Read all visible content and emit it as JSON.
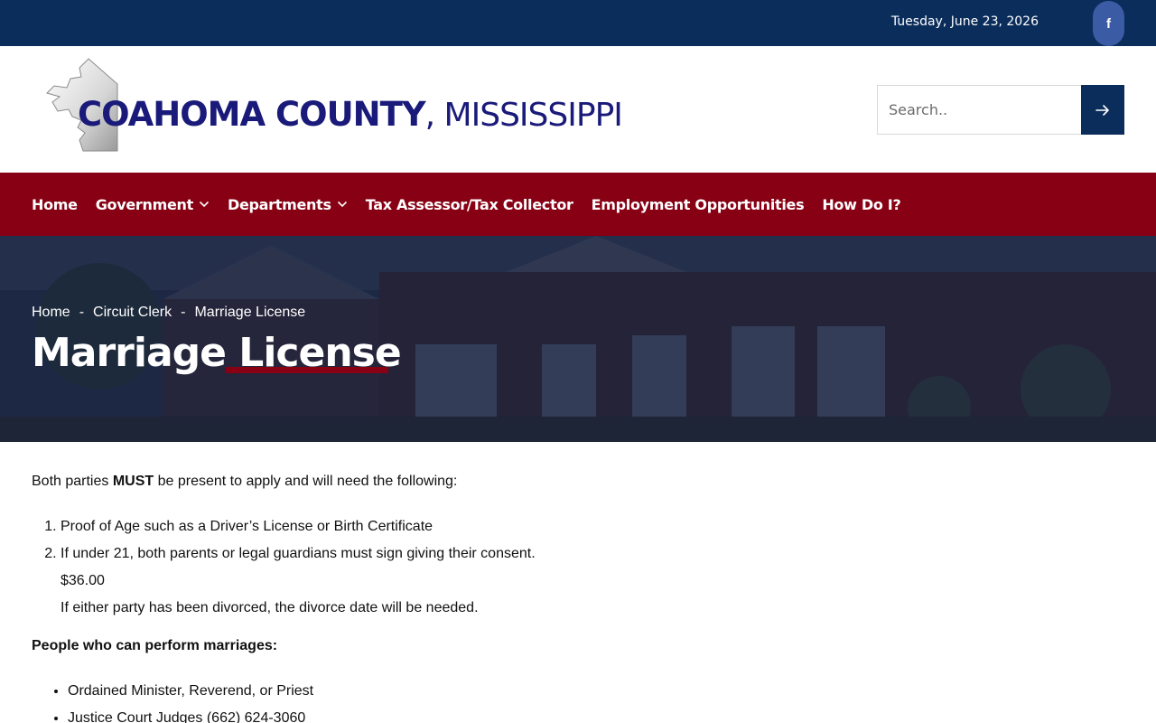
{
  "topbar": {
    "date": "Tuesday, June 23, 2026",
    "facebook_icon": "facebook-icon",
    "facebook_label": "f"
  },
  "logo": {
    "county": "COAHOMA COUNTY",
    "state": ", MISSISSIPPI"
  },
  "search": {
    "placeholder": "Search..",
    "submit_icon": "arrow-right-icon"
  },
  "nav": {
    "items": [
      {
        "label": "Home",
        "has_dropdown": false
      },
      {
        "label": "Government",
        "has_dropdown": true
      },
      {
        "label": "Departments",
        "has_dropdown": true
      },
      {
        "label": "Tax Assessor/Tax Collector",
        "has_dropdown": false
      },
      {
        "label": "Employment Opportunities",
        "has_dropdown": false
      },
      {
        "label": "How Do I?",
        "has_dropdown": false
      }
    ]
  },
  "hero": {
    "breadcrumb": [
      "Home",
      "Circuit Clerk",
      "Marriage License"
    ],
    "separator": "-",
    "title": "Marriage License"
  },
  "content": {
    "lead_prefix": "Both parties ",
    "lead_strong": "MUST",
    "lead_suffix": " be present to apply and will need the following:",
    "requirements": [
      "Proof of Age such as a Driver’s License or Birth Certificate",
      "If under 21, both parents or legal guardians must sign giving their consent."
    ],
    "fee": "$36.00",
    "divorce_note": "If either party has been divorced, the divorce date will be needed.",
    "performers_heading": "People who can perform marriages:",
    "performers": [
      "Ordained Minister, Reverend, or Priest",
      "Justice Court Judges  (662) 624-3060"
    ]
  },
  "colors": {
    "topbar": "#0b2d5b",
    "nav": "#870014",
    "logo_text": "#1a1a7a",
    "facebook": "#3b5ca5"
  }
}
